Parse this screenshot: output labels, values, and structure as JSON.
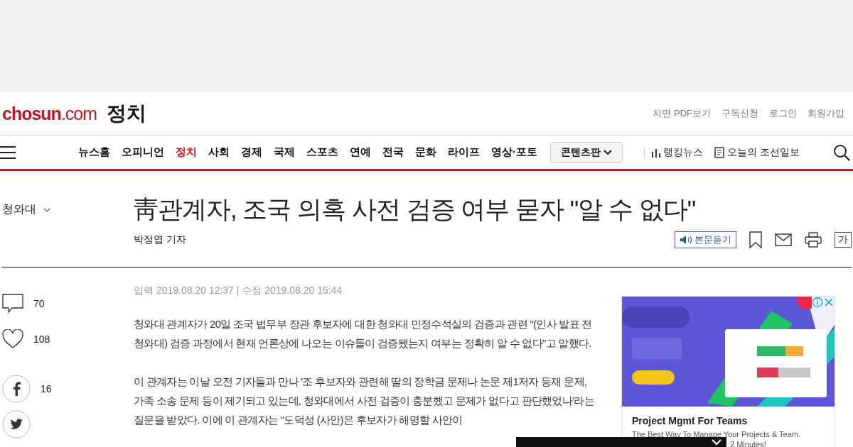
{
  "top_links": [
    "지면 PDF보기",
    "구독신청",
    "로그인",
    "회원가입"
  ],
  "logo": "**chosun**.com",
  "section_title": "정치",
  "nav": {
    "items": [
      {
        "label": "뉴스홈",
        "selected": false
      },
      {
        "label": "오피니언",
        "selected": false
      },
      {
        "label": "정치",
        "selected": true
      },
      {
        "label": "사회",
        "selected": false
      },
      {
        "label": "경제",
        "selected": false
      },
      {
        "label": "국제",
        "selected": false
      },
      {
        "label": "스포츠",
        "selected": false
      },
      {
        "label": "연예",
        "selected": false
      },
      {
        "label": "전국",
        "selected": false
      },
      {
        "label": "문화",
        "selected": false
      },
      {
        "label": "라이프",
        "selected": false
      },
      {
        "label": "영상·포토",
        "selected": false
      }
    ],
    "dropdown": "콘텐츠판",
    "extras": [
      {
        "kind": "ranking",
        "label": "랭킹뉴스"
      },
      {
        "kind": "paper",
        "label": "오늘의 조선일보"
      }
    ]
  },
  "category": "청와대",
  "headline": "靑관계자, 조국 의혹 사전 검증 여부 묻자 \"알 수 없다\"",
  "byline": "박정엽 기자",
  "listen_button": "본문듣기",
  "font_button": "가",
  "stats": [
    {
      "kind": "comment",
      "count": "70"
    },
    {
      "kind": "like",
      "count": "108"
    },
    {
      "kind": "facebook",
      "count": "16"
    },
    {
      "kind": "twitter"
    }
  ],
  "timestamp": "입력 2019.08.20 12:37 | 수정 2019.08.20 15:44",
  "paragraphs": [
    "청와대 관계자가 20일 조국 법무부 장관 후보자에 대한 청와대 민정수석실의 검증과 관련 \"(인사 발표 전 청와대) 검증 과정에서 현재 언론상에 나오는 이슈들이 검증됐는지 여부는 정확히 알 수 없다\"고 말했다.",
    "이 관계자는 이날 오전 기자들과 만나 '조 후보자와 관련해 딸의 장학금 문제나 논문 제1저자 등재 문제, 가족 소송 문제 등이 제기되고 있는데, 청와대에서 사전 검증이 충분했고 문제가 없다고 판단했었나'라는 질문을 받았다. 이에 이 관계자는 \"도덕성 (사안)은 후보자가 해명할 사안이"
  ],
  "ad": {
    "title": "Project Mgmt For Teams",
    "description": "The Best Way To Manage Your Projects & Team.",
    "description_tail": "2 Minutes!"
  }
}
